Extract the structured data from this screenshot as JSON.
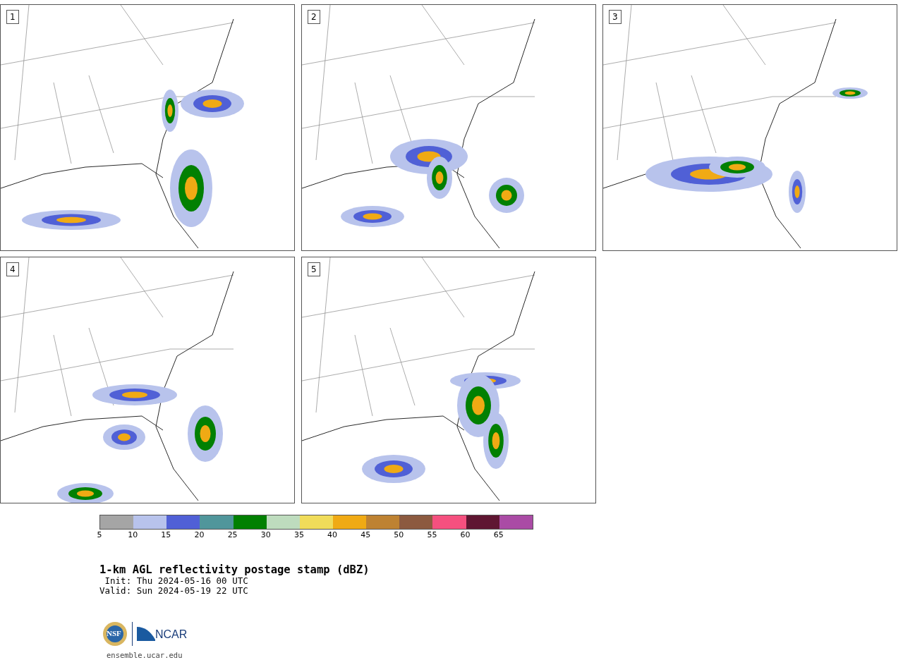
{
  "panels": [
    {
      "label": "1"
    },
    {
      "label": "2"
    },
    {
      "label": "3"
    },
    {
      "label": "4"
    },
    {
      "label": "5"
    }
  ],
  "colorbar": [
    {
      "label": "5",
      "color": "#a5a5a5"
    },
    {
      "label": "10",
      "color": "#b8c3ec"
    },
    {
      "label": "15",
      "color": "#5060d6"
    },
    {
      "label": "20",
      "color": "#50969b"
    },
    {
      "label": "25",
      "color": "#028002"
    },
    {
      "label": "30",
      "color": "#bedcbe"
    },
    {
      "label": "35",
      "color": "#f0dc5a"
    },
    {
      "label": "40",
      "color": "#f0aa14"
    },
    {
      "label": "45",
      "color": "#be8232"
    },
    {
      "label": "50",
      "color": "#8c5a40"
    },
    {
      "label": "55",
      "color": "#f5507f"
    },
    {
      "label": "60",
      "color": "#5f1632"
    },
    {
      "label": "65",
      "color": "#aa4ba5"
    }
  ],
  "title": "1-km AGL reflectivity postage stamp (dBZ)",
  "init": " Init: Thu 2024-05-16 00 UTC",
  "valid": "Valid: Sun 2024-05-19 22 UTC",
  "logo": {
    "nsf": "NSF",
    "ncar": "NCAR"
  },
  "url": "ensemble.ucar.edu"
}
